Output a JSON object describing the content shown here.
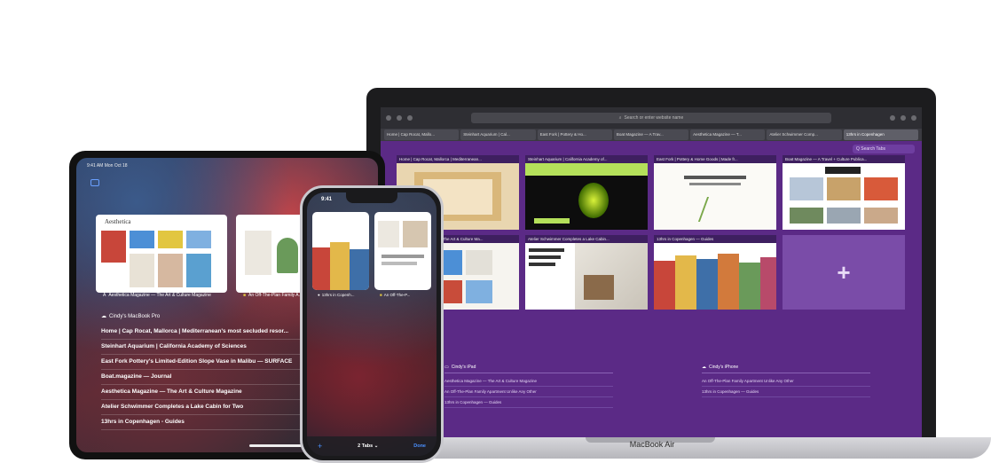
{
  "macbook": {
    "url_placeholder": "Search or enter website name",
    "tabs": [
      "Home | Cap Rocat, Mallo...",
      "Steinhart Aquarium | Cal...",
      "East Fork | Pottery & Ho...",
      "Boat Magazine — A Trav...",
      "Aesthetica Magazine — T...",
      "Atelier Schwimmer Comp...",
      "13hrs in Copenhagen"
    ],
    "active_tab": 6,
    "edit_label": "Q  Search Tabs",
    "cards": [
      {
        "title": "Home | Cap Rocat, Mallorca | Mediterranean..."
      },
      {
        "title": "Steinhart Aquarium | California Academy of..."
      },
      {
        "title": "East Fork | Pottery & Home Goods | Made fr..."
      },
      {
        "title": "Boat Magazine — A Travel + Culture Publica..."
      },
      {
        "title": "Aesthetica Magazine — The Art & Culture Ma..."
      },
      {
        "title": "Atelier Schwimmer Completes a Lake Cabin..."
      },
      {
        "title": "13hrs in Copenhagen — Guides"
      }
    ],
    "add_tab": "+",
    "sections": [
      {
        "device": "Cindy's iPad",
        "items": [
          "Aesthetica Magazine — The Art & Culture Magazine",
          "An Off-The-Plan Family Apartment Unlike Any Other",
          "13hrs in Copenhagen — Guides"
        ]
      },
      {
        "device": "Cindy's iPhone",
        "items": [
          "An Off-The-Plan Family Apartment Unlike Any Other",
          "13hrs in Copenhagen — Guides"
        ]
      }
    ],
    "model_label": "MacBook Air"
  },
  "ipad": {
    "status": "9:41 AM   Mon Oct 18",
    "cards": [
      {
        "label": "Aesthetica Magazine — The Art & Culture Magazine",
        "heading": "Aesthetica"
      },
      {
        "label": "An Off-The-Plan Family A..."
      }
    ],
    "list_header": "Cindy's MacBook Pro",
    "rows": [
      "Home | Cap Rocat, Mallorca | Mediterranean's most secluded resor...",
      "Steinhart Aquarium | California Academy of Sciences",
      "East Fork Pottery's Limited-Edition Slope Vase in Malibu — SURFACE",
      "Boat.magazine — Journal",
      "Aesthetica Magazine — The Art & Culture Magazine",
      "Atelier Schwimmer Completes a Lake Cabin for Two",
      "13hrs in Copenhagen - Guides"
    ]
  },
  "iphone": {
    "time": "9:41",
    "cards": [
      {
        "label": "13hrs in Copenh..."
      },
      {
        "label": "An Off-The-P..."
      }
    ],
    "plus": "+",
    "tabs_label": "2 Tabs ⌄",
    "done_label": "Done"
  },
  "colors": {
    "mac_bg": "#5b2a86",
    "accent": "#4a90ff"
  }
}
